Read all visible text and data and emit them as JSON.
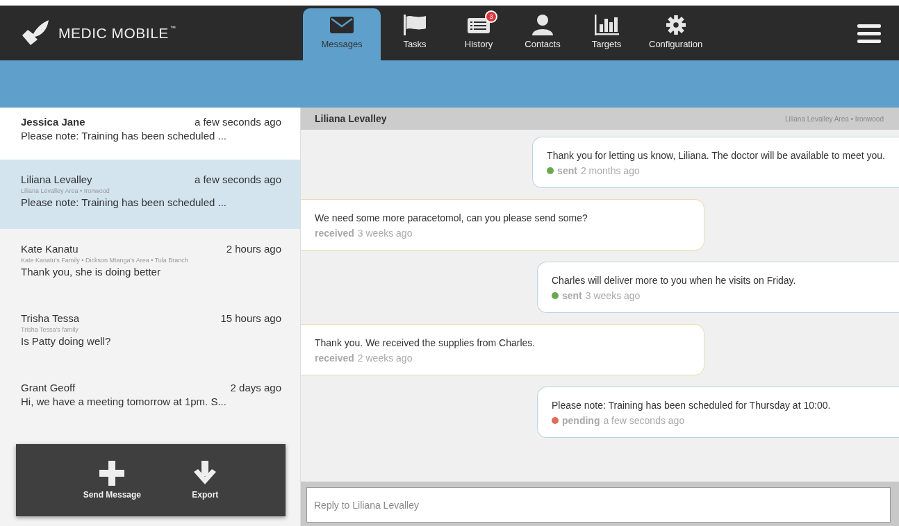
{
  "logo": {
    "name": "MEDIC MOBILE",
    "mark": "™"
  },
  "tabs": [
    {
      "label": "Messages",
      "selected": true
    },
    {
      "label": "Tasks",
      "selected": false
    },
    {
      "label": "History",
      "selected": false,
      "badge": "3"
    },
    {
      "label": "Contacts",
      "selected": false
    },
    {
      "label": "Targets",
      "selected": false
    },
    {
      "label": "Configuration",
      "selected": false
    }
  ],
  "conversations": [
    {
      "name": "Jessica Jane",
      "time": "a few seconds ago",
      "preview": "Please note: Training has been scheduled ...",
      "unread": true,
      "selected": false
    },
    {
      "name": "Liliana Levalley",
      "time": "a few seconds ago",
      "place": "Liliana Levalley Area • Ironwood",
      "preview": "Please note: Training has been scheduled ...",
      "unread": false,
      "selected": true
    },
    {
      "name": "Kate Kanatu",
      "time": "2 hours ago",
      "place": "Kate Kanatu's Family • Dickson Mtanga's Area • Tula Branch",
      "preview": "Thank you, she is doing better",
      "unread": false,
      "selected": false
    },
    {
      "name": "Trisha Tessa",
      "time": "15 hours ago",
      "place": "Trisha Tessa's family",
      "preview": "Is Patty doing well?",
      "unread": false,
      "selected": false
    },
    {
      "name": "Grant Geoff",
      "time": "2 days ago",
      "preview": "Hi, we have a meeting tomorrow at 1pm. S...",
      "unread": false,
      "selected": false
    }
  ],
  "actions": [
    {
      "label": "Send Message"
    },
    {
      "label": "Export"
    }
  ],
  "chat": {
    "title": "Liliana Levalley",
    "place": "Liliana Levalley Area • Ironwood",
    "messages": [
      {
        "kind": "sent",
        "text": "Thank you for letting us know, Liliana. The doctor will be available to meet you.",
        "status": "sent",
        "time": "2 months ago",
        "color": "#6aa84f"
      },
      {
        "kind": "received",
        "text": "We need some more paracetomol, can you please send some?",
        "status": "received",
        "time": "3 weeks ago"
      },
      {
        "kind": "sent",
        "text": "Charles will deliver more to you when he visits on Friday.",
        "status": "sent",
        "time": "3 weeks ago",
        "color": "#6aa84f"
      },
      {
        "kind": "received",
        "text": "Thank you. We received the supplies from Charles.",
        "status": "received",
        "time": "2 weeks ago"
      },
      {
        "kind": "sent",
        "text": "Please note: Training has been scheduled for Thursday at 10:00.",
        "status": "pending",
        "time": "a few seconds ago",
        "color": "#e06c5a"
      }
    ],
    "reply": {
      "placeholder": "Reply to Liliana Levalley"
    }
  }
}
